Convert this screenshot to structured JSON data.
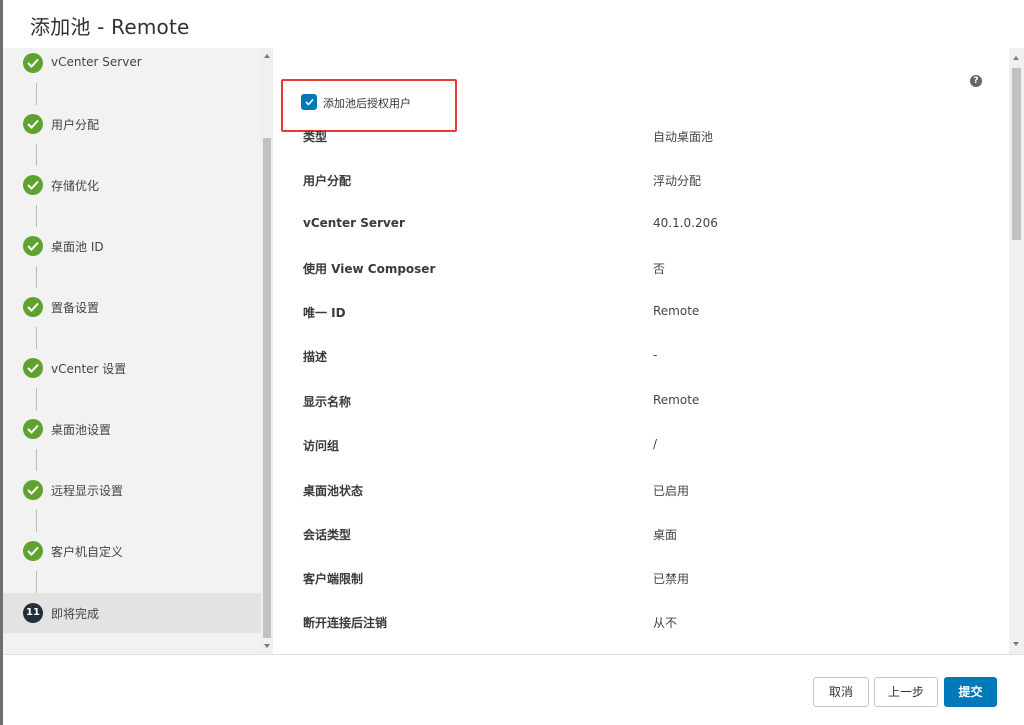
{
  "title": "添加池 - Remote",
  "sidebar": {
    "steps": [
      {
        "label": "vCenter Server",
        "status": "done"
      },
      {
        "label": "用户分配",
        "status": "done"
      },
      {
        "label": "存储优化",
        "status": "done"
      },
      {
        "label": "桌面池 ID",
        "status": "done"
      },
      {
        "label": "置备设置",
        "status": "done"
      },
      {
        "label": "vCenter 设置",
        "status": "done"
      },
      {
        "label": "桌面池设置",
        "status": "done"
      },
      {
        "label": "远程显示设置",
        "status": "done"
      },
      {
        "label": "客户机自定义",
        "status": "done"
      },
      {
        "label": "即将完成",
        "status": "current",
        "number": "11"
      }
    ]
  },
  "main": {
    "help_icon": "?",
    "entitle_checkbox": {
      "label": "添加池后授权用户",
      "checked": true
    },
    "summary": [
      {
        "key": "类型",
        "value": "自动桌面池"
      },
      {
        "key": "用户分配",
        "value": "浮动分配"
      },
      {
        "key": "vCenter Server",
        "value": "40.1.0.206"
      },
      {
        "key": "使用 View Composer",
        "value": "否"
      },
      {
        "key": "唯一 ID",
        "value": "Remote"
      },
      {
        "key": "描述",
        "value": "-"
      },
      {
        "key": "显示名称",
        "value": "Remote"
      },
      {
        "key": "访问组",
        "value": "/"
      },
      {
        "key": "桌面池状态",
        "value": "已启用"
      },
      {
        "key": "会话类型",
        "value": "桌面"
      },
      {
        "key": "客户端限制",
        "value": "已禁用"
      },
      {
        "key": "断开连接后注销",
        "value": "从不"
      }
    ]
  },
  "footer": {
    "cancel_label": "取消",
    "back_label": "上一步",
    "submit_label": "提交"
  },
  "colors": {
    "accent": "#0079b8",
    "done": "#5fa22f",
    "highlight": "#e53935"
  }
}
